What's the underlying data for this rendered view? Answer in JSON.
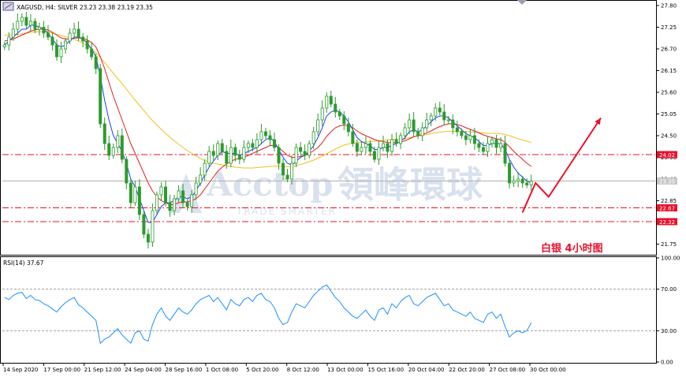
{
  "header": {
    "symbol_line": "XAGUSD, H4:  SILVER  23.23 23.38 23.19 23.35",
    "rsi_label": "RSI(14) 37.67",
    "annotation": "白银  4小时图"
  },
  "watermark": {
    "brand": "Acctop",
    "chinese": "領峰環球",
    "tagline": "TRADE SMARTER"
  },
  "colors": {
    "bull": "#2e9a2e",
    "bear": "#2e9a2e",
    "ma_fast": "#1f3fff",
    "ma_mid": "#e02020",
    "ma_slow": "#f2c11e",
    "rsi": "#1e90ff",
    "support": "#e8112d",
    "current": "#b0b0b0",
    "arrow": "#e8112d"
  },
  "chart_data": [
    {
      "type": "candlestick",
      "symbol": "XAGUSD",
      "timeframe": "H4",
      "ylim": [
        21.5,
        27.9
      ],
      "y_ticks": [
        "27.80",
        "27.25",
        "26.70",
        "26.15",
        "25.60",
        "25.05",
        "24.50",
        "23.95",
        "23.40",
        "22.85",
        "22.30",
        "21.75"
      ],
      "x_ticks": [
        "14 Sep 2020",
        "17 Sep 00:00",
        "21 Sep 12:00",
        "24 Sep 04:00",
        "28 Sep 16:00",
        "1 Oct 08:00",
        "5 Oct 20:00",
        "8 Oct 12:00",
        "13 Oct 00:00",
        "15 Oct 16:00",
        "20 Oct 04:00",
        "22 Oct 20:00",
        "27 Oct 08:00",
        "30 Oct 00:00"
      ],
      "closes": [
        26.8,
        27.0,
        27.2,
        27.4,
        27.5,
        27.3,
        27.4,
        27.2,
        27.25,
        27.1,
        27.0,
        26.8,
        26.5,
        26.7,
        26.9,
        27.1,
        27.2,
        27.0,
        26.9,
        26.7,
        26.5,
        26.2,
        24.8,
        24.3,
        24.0,
        24.2,
        24.5,
        23.9,
        23.3,
        22.8,
        23.2,
        22.5,
        22.0,
        21.8,
        22.6,
        23.0,
        23.2,
        22.8,
        22.6,
        22.9,
        23.1,
        22.8,
        22.7,
        23.0,
        23.3,
        23.5,
        23.8,
        24.1,
        24.0,
        24.3,
        24.1,
        23.8,
        24.2,
        24.0,
        23.9,
        24.2,
        24.3,
        24.2,
        24.4,
        24.6,
        24.5,
        24.4,
        24.2,
        23.8,
        23.5,
        23.4,
        23.8,
        24.2,
        24.1,
        24.0,
        24.3,
        24.6,
        24.9,
        25.2,
        25.5,
        25.3,
        25.1,
        25.0,
        24.8,
        24.6,
        24.3,
        24.1,
        24.2,
        24.3,
        24.1,
        23.9,
        24.2,
        24.3,
        24.1,
        24.4,
        24.3,
        24.5,
        24.7,
        24.9,
        24.6,
        24.5,
        24.7,
        24.9,
        25.0,
        25.2,
        25.1,
        24.9,
        24.9,
        24.7,
        24.6,
        24.5,
        24.4,
        24.5,
        24.3,
        24.2,
        24.1,
        24.3,
        24.4,
        24.2,
        24.3,
        23.8,
        23.3,
        23.35,
        23.4,
        23.3,
        23.25,
        23.35
      ],
      "ma_fast": [
        26.8,
        26.9,
        27.0,
        27.1,
        27.2,
        27.2,
        27.3,
        27.3,
        27.25,
        27.2,
        27.1,
        26.95,
        26.8,
        26.75,
        26.8,
        26.9,
        27.0,
        27.0,
        26.95,
        26.85,
        26.7,
        26.5,
        26.0,
        25.4,
        24.9,
        24.5,
        24.3,
        24.1,
        23.8,
        23.4,
        23.2,
        22.9,
        22.6,
        22.3,
        22.3,
        22.5,
        22.7,
        22.8,
        22.8,
        22.85,
        22.95,
        22.95,
        22.9,
        22.95,
        23.1,
        23.3,
        23.5,
        23.7,
        23.85,
        24.0,
        24.1,
        24.05,
        24.05,
        24.05,
        24.0,
        24.05,
        24.1,
        24.15,
        24.2,
        24.3,
        24.4,
        24.45,
        24.35,
        24.15,
        23.95,
        23.8,
        23.75,
        23.85,
        23.95,
        24.0,
        24.1,
        24.25,
        24.45,
        24.7,
        25.0,
        25.1,
        25.15,
        25.1,
        25.0,
        24.85,
        24.65,
        24.45,
        24.35,
        24.3,
        24.25,
        24.15,
        24.15,
        24.2,
        24.2,
        24.25,
        24.3,
        24.35,
        24.45,
        24.6,
        24.65,
        24.6,
        24.65,
        24.75,
        24.85,
        24.95,
        25.0,
        25.0,
        24.95,
        24.85,
        24.75,
        24.65,
        24.55,
        24.5,
        24.45,
        24.35,
        24.25,
        24.25,
        24.3,
        24.3,
        24.3,
        24.15,
        23.9,
        23.7,
        23.55,
        23.45,
        23.35,
        23.3
      ],
      "ma_mid": [
        26.9,
        26.92,
        26.95,
        27.0,
        27.05,
        27.1,
        27.15,
        27.18,
        27.2,
        27.2,
        27.18,
        27.12,
        27.05,
        26.98,
        26.95,
        26.95,
        26.97,
        26.98,
        26.97,
        26.93,
        26.86,
        26.75,
        26.5,
        26.2,
        25.85,
        25.5,
        25.2,
        24.9,
        24.6,
        24.3,
        24.05,
        23.8,
        23.55,
        23.3,
        23.1,
        22.95,
        22.85,
        22.8,
        22.75,
        22.75,
        22.8,
        22.82,
        22.82,
        22.85,
        22.9,
        23.0,
        23.15,
        23.3,
        23.45,
        23.6,
        23.7,
        23.78,
        23.85,
        23.9,
        23.92,
        23.95,
        24.0,
        24.05,
        24.1,
        24.15,
        24.2,
        24.25,
        24.25,
        24.2,
        24.1,
        24.0,
        23.95,
        23.95,
        23.97,
        24.0,
        24.05,
        24.12,
        24.2,
        24.32,
        24.48,
        24.6,
        24.7,
        24.75,
        24.77,
        24.75,
        24.7,
        24.62,
        24.55,
        24.5,
        24.45,
        24.4,
        24.37,
        24.35,
        24.33,
        24.32,
        24.32,
        24.34,
        24.37,
        24.42,
        24.47,
        24.5,
        24.53,
        24.57,
        24.62,
        24.68,
        24.73,
        24.77,
        24.8,
        24.8,
        24.78,
        24.75,
        24.7,
        24.66,
        24.62,
        24.57,
        24.52,
        24.48,
        24.45,
        24.42,
        24.4,
        24.33,
        24.22,
        24.1,
        24.0,
        23.9,
        23.8,
        23.72
      ],
      "ma_slow": [
        27.05,
        27.05,
        27.06,
        27.07,
        27.08,
        27.1,
        27.12,
        27.13,
        27.14,
        27.14,
        27.13,
        27.1,
        27.07,
        27.04,
        27.01,
        26.98,
        26.94,
        26.9,
        26.85,
        26.78,
        26.7,
        26.6,
        26.48,
        26.35,
        26.22,
        26.08,
        25.95,
        25.82,
        25.68,
        25.54,
        25.4,
        25.27,
        25.14,
        25.0,
        24.88,
        24.77,
        24.66,
        24.56,
        24.46,
        24.37,
        24.28,
        24.2,
        24.12,
        24.05,
        23.98,
        23.92,
        23.87,
        23.83,
        23.8,
        23.78,
        23.76,
        23.74,
        23.72,
        23.7,
        23.69,
        23.68,
        23.68,
        23.68,
        23.69,
        23.7,
        23.71,
        23.72,
        23.73,
        23.73,
        23.72,
        23.71,
        23.72,
        23.74,
        23.77,
        23.8,
        23.84,
        23.88,
        23.93,
        23.98,
        24.04,
        24.1,
        24.16,
        24.21,
        24.26,
        24.29,
        24.31,
        24.32,
        24.33,
        24.34,
        24.35,
        24.36,
        24.37,
        24.38,
        24.39,
        24.4,
        24.41,
        24.42,
        24.43,
        24.45,
        24.47,
        24.49,
        24.51,
        24.53,
        24.55,
        24.57,
        24.59,
        24.6,
        24.61,
        24.61,
        24.61,
        24.61,
        24.6,
        24.6,
        24.59,
        24.58,
        24.57,
        24.56,
        24.56,
        24.55,
        24.55,
        24.53,
        24.5,
        24.46,
        24.42,
        24.39,
        24.36,
        24.33
      ],
      "horizontal_lines": [
        {
          "value": 24.02,
          "label": "24.02",
          "style": "dash-dot"
        },
        {
          "value": 22.67,
          "label": "22.67",
          "style": "dash-dot"
        },
        {
          "value": 22.32,
          "label": "22.32",
          "style": "dash-dot"
        },
        {
          "value": 23.35,
          "label": "23.35",
          "style": "current"
        }
      ],
      "forecast_path": [
        {
          "i": 119,
          "v": 22.55
        },
        {
          "i": 122,
          "v": 23.3
        },
        {
          "i": 125,
          "v": 22.95
        },
        {
          "i": 137,
          "v": 24.95
        }
      ],
      "grid": false
    },
    {
      "type": "line",
      "name": "RSI(14)",
      "ylim": [
        0,
        100
      ],
      "y_ticks": [
        "100.00",
        "70.00",
        "30.00",
        "0.00"
      ],
      "levels": [
        70,
        30
      ],
      "values": [
        62,
        60,
        64,
        66,
        67,
        61,
        64,
        60,
        59,
        56,
        54,
        51,
        48,
        53,
        57,
        60,
        62,
        55,
        52,
        48,
        44,
        40,
        18,
        22,
        24,
        28,
        32,
        26,
        22,
        18,
        28,
        30,
        22,
        20,
        36,
        46,
        52,
        44,
        40,
        46,
        52,
        48,
        46,
        50,
        56,
        60,
        62,
        64,
        58,
        62,
        56,
        50,
        60,
        56,
        54,
        60,
        62,
        58,
        64,
        66,
        60,
        58,
        52,
        42,
        36,
        38,
        48,
        56,
        54,
        52,
        58,
        64,
        68,
        72,
        74,
        68,
        62,
        58,
        52,
        48,
        44,
        42,
        46,
        50,
        44,
        40,
        50,
        52,
        46,
        56,
        52,
        58,
        62,
        64,
        56,
        54,
        58,
        62,
        64,
        66,
        60,
        54,
        56,
        50,
        48,
        46,
        44,
        48,
        42,
        40,
        38,
        46,
        48,
        42,
        46,
        34,
        24,
        28,
        30,
        28,
        30,
        37.67
      ],
      "grid": false
    }
  ]
}
